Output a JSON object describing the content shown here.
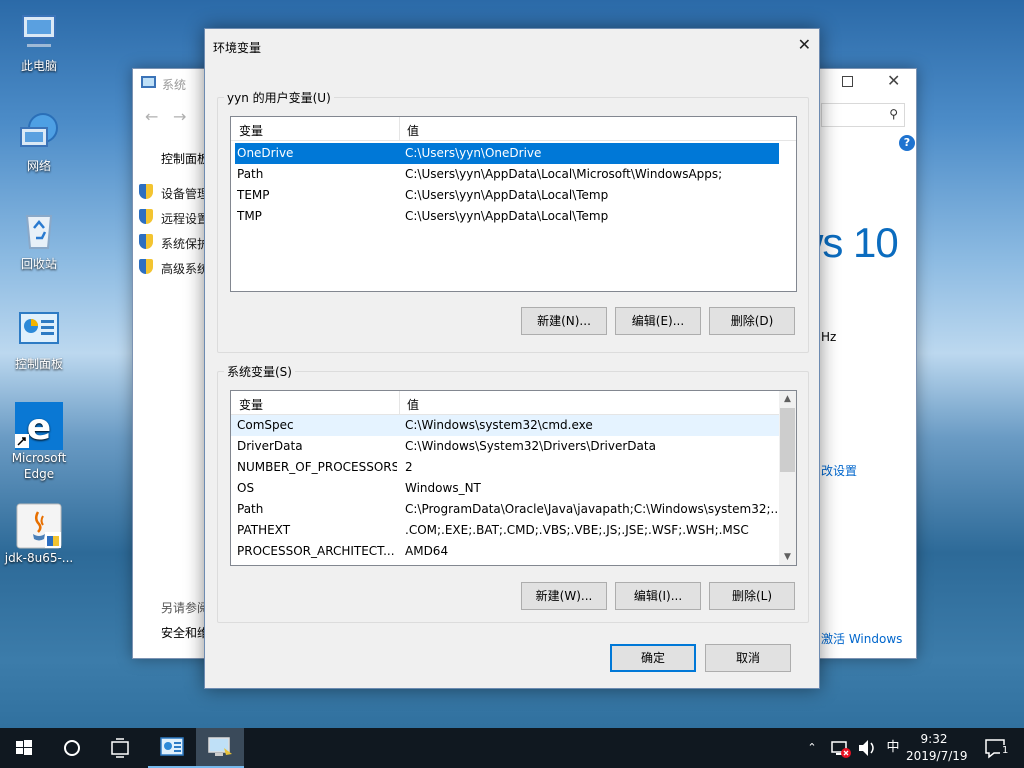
{
  "desktop": {
    "icons": [
      {
        "label": "此电脑",
        "icon": "this-pc-icon"
      },
      {
        "label": "网络",
        "icon": "network-icon"
      },
      {
        "label": "回收站",
        "icon": "recycle-bin-icon"
      },
      {
        "label": "控制面板",
        "icon": "control-panel-icon"
      },
      {
        "label": "Microsoft Edge",
        "icon": "edge-icon"
      },
      {
        "label": "jdk-8u65-...",
        "icon": "java-installer-icon"
      }
    ]
  },
  "system_window": {
    "title": "系统",
    "nav_header": "控制面板",
    "links": [
      "设备管理",
      "远程设置",
      "系统保护",
      "高级系统"
    ],
    "see_also": "另请参阅",
    "security": "安全和维护",
    "brand": "ws 10",
    "cpu_frag": "Hz",
    "change_settings": "改设置",
    "activate": "激活 Windows"
  },
  "env_dialog": {
    "title": "环境变量",
    "user_group_label": "yyn 的用户变量(U)",
    "sys_group_label": "系统变量(S)",
    "col_var": "变量",
    "col_val": "值",
    "user_vars": [
      {
        "name": "OneDrive",
        "value": "C:\\Users\\yyn\\OneDrive"
      },
      {
        "name": "Path",
        "value": "C:\\Users\\yyn\\AppData\\Local\\Microsoft\\WindowsApps;"
      },
      {
        "name": "TEMP",
        "value": "C:\\Users\\yyn\\AppData\\Local\\Temp"
      },
      {
        "name": "TMP",
        "value": "C:\\Users\\yyn\\AppData\\Local\\Temp"
      }
    ],
    "sys_vars": [
      {
        "name": "ComSpec",
        "value": "C:\\Windows\\system32\\cmd.exe"
      },
      {
        "name": "DriverData",
        "value": "C:\\Windows\\System32\\Drivers\\DriverData"
      },
      {
        "name": "NUMBER_OF_PROCESSORS",
        "value": "2"
      },
      {
        "name": "OS",
        "value": "Windows_NT"
      },
      {
        "name": "Path",
        "value": "C:\\ProgramData\\Oracle\\Java\\javapath;C:\\Windows\\system32;..."
      },
      {
        "name": "PATHEXT",
        "value": ".COM;.EXE;.BAT;.CMD;.VBS;.VBE;.JS;.JSE;.WSF;.WSH;.MSC"
      },
      {
        "name": "PROCESSOR_ARCHITECT...",
        "value": "AMD64"
      }
    ],
    "user_buttons": {
      "new": "新建(N)...",
      "edit": "编辑(E)...",
      "delete": "删除(D)"
    },
    "sys_buttons": {
      "new": "新建(W)...",
      "edit": "编辑(I)...",
      "delete": "删除(L)"
    },
    "ok": "确定",
    "cancel": "取消"
  },
  "taskbar": {
    "ime": "中",
    "time": "9:32",
    "date": "2019/7/19",
    "notification_count": "1"
  },
  "colors": {
    "accent": "#0078d7",
    "taskbar": "#101820",
    "dialog_bg": "#f0f0f0"
  }
}
